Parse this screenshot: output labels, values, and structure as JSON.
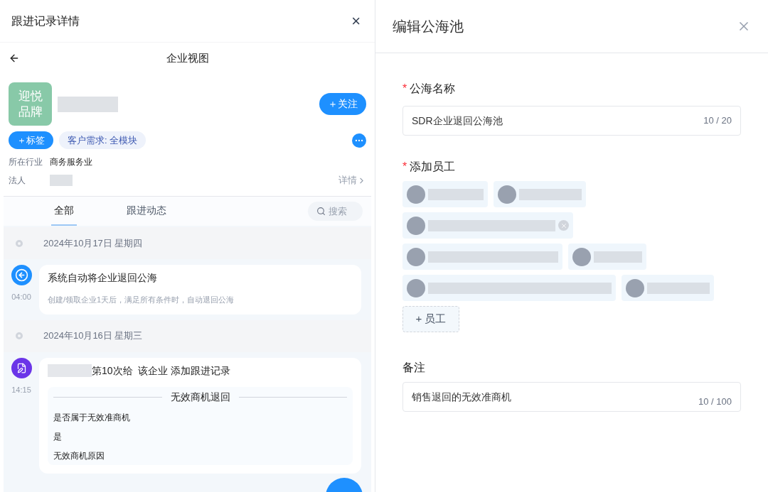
{
  "left_panel": {
    "title": "跟进记录详情",
    "close": "×",
    "view_title": "企业视图",
    "company": {
      "logo_text": "迎悦品牌",
      "follow_button": "＋关注",
      "tag_button": "＋标签",
      "need_tag": "客户需求: 全模块",
      "fields": [
        {
          "label": "所在行业",
          "value": "商务服务业"
        },
        {
          "label": "法人"
        }
      ],
      "details_link": "详情"
    },
    "tabs": [
      {
        "label": "全部",
        "selected": true
      },
      {
        "label": "跟进动态",
        "selected": false
      }
    ],
    "search": {
      "placeholder": "搜索"
    },
    "timeline": [
      {
        "date": "2024年10月17日 星期四",
        "entries": [
          {
            "kind": "system",
            "time": "04:00",
            "title": "系统自动将企业退回公海",
            "note": "创建/领取企业1天后，满足所有条件时，自动退回公海"
          }
        ]
      },
      {
        "date": "2024年10月16日 星期三",
        "entries": [
          {
            "kind": "record",
            "time": "14:15",
            "title": "第10次给  该企业 添加跟进记录",
            "section": {
              "heading": "无效商机退回",
              "lines": [
                "是否属于无效准商机",
                "是",
                "无效商机原因"
              ]
            }
          }
        ]
      }
    ]
  },
  "dialog": {
    "title": "编辑公海池",
    "name_field": {
      "label": "公海名称",
      "mark": "*",
      "value": "SDR企业退回公海池",
      "count": "10 / 20"
    },
    "employees_field": {
      "label": "添加员工",
      "mark": "*",
      "rows": [
        [
          {
            "removable": false
          },
          {
            "removable": false
          }
        ],
        [
          {
            "removable": true
          }
        ],
        [
          {
            "removable": false
          },
          {
            "removable": false
          }
        ],
        [
          {
            "removable": false
          },
          {
            "removable": false
          }
        ]
      ],
      "add_button": "+ 员工"
    },
    "remark_field": {
      "label": "备注",
      "value": "销售退回的无效准商机",
      "count": "10 / 100"
    }
  }
}
